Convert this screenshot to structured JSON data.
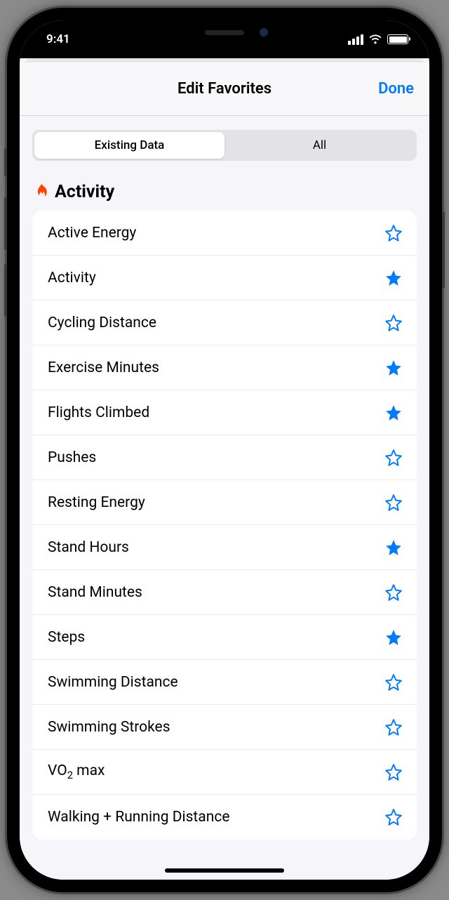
{
  "status": {
    "time": "9:41"
  },
  "nav": {
    "title": "Edit Favorites",
    "done": "Done"
  },
  "segmented": {
    "options": [
      {
        "label": "Existing Data",
        "selected": true
      },
      {
        "label": "All",
        "selected": false
      }
    ]
  },
  "section": {
    "icon": "flame-icon",
    "title": "Activity",
    "items": [
      {
        "label": "Active Energy",
        "favorite": false
      },
      {
        "label": "Activity",
        "favorite": true
      },
      {
        "label": "Cycling Distance",
        "favorite": false
      },
      {
        "label": "Exercise Minutes",
        "favorite": true
      },
      {
        "label": "Flights Climbed",
        "favorite": true
      },
      {
        "label": "Pushes",
        "favorite": false
      },
      {
        "label": "Resting Energy",
        "favorite": false
      },
      {
        "label": "Stand Hours",
        "favorite": true
      },
      {
        "label": "Stand Minutes",
        "favorite": false
      },
      {
        "label": "Steps",
        "favorite": true
      },
      {
        "label": "Swimming Distance",
        "favorite": false
      },
      {
        "label": "Swimming Strokes",
        "favorite": false
      },
      {
        "label": "VO₂ max",
        "favorite": false
      },
      {
        "label": "Walking + Running Distance",
        "favorite": false
      }
    ]
  }
}
